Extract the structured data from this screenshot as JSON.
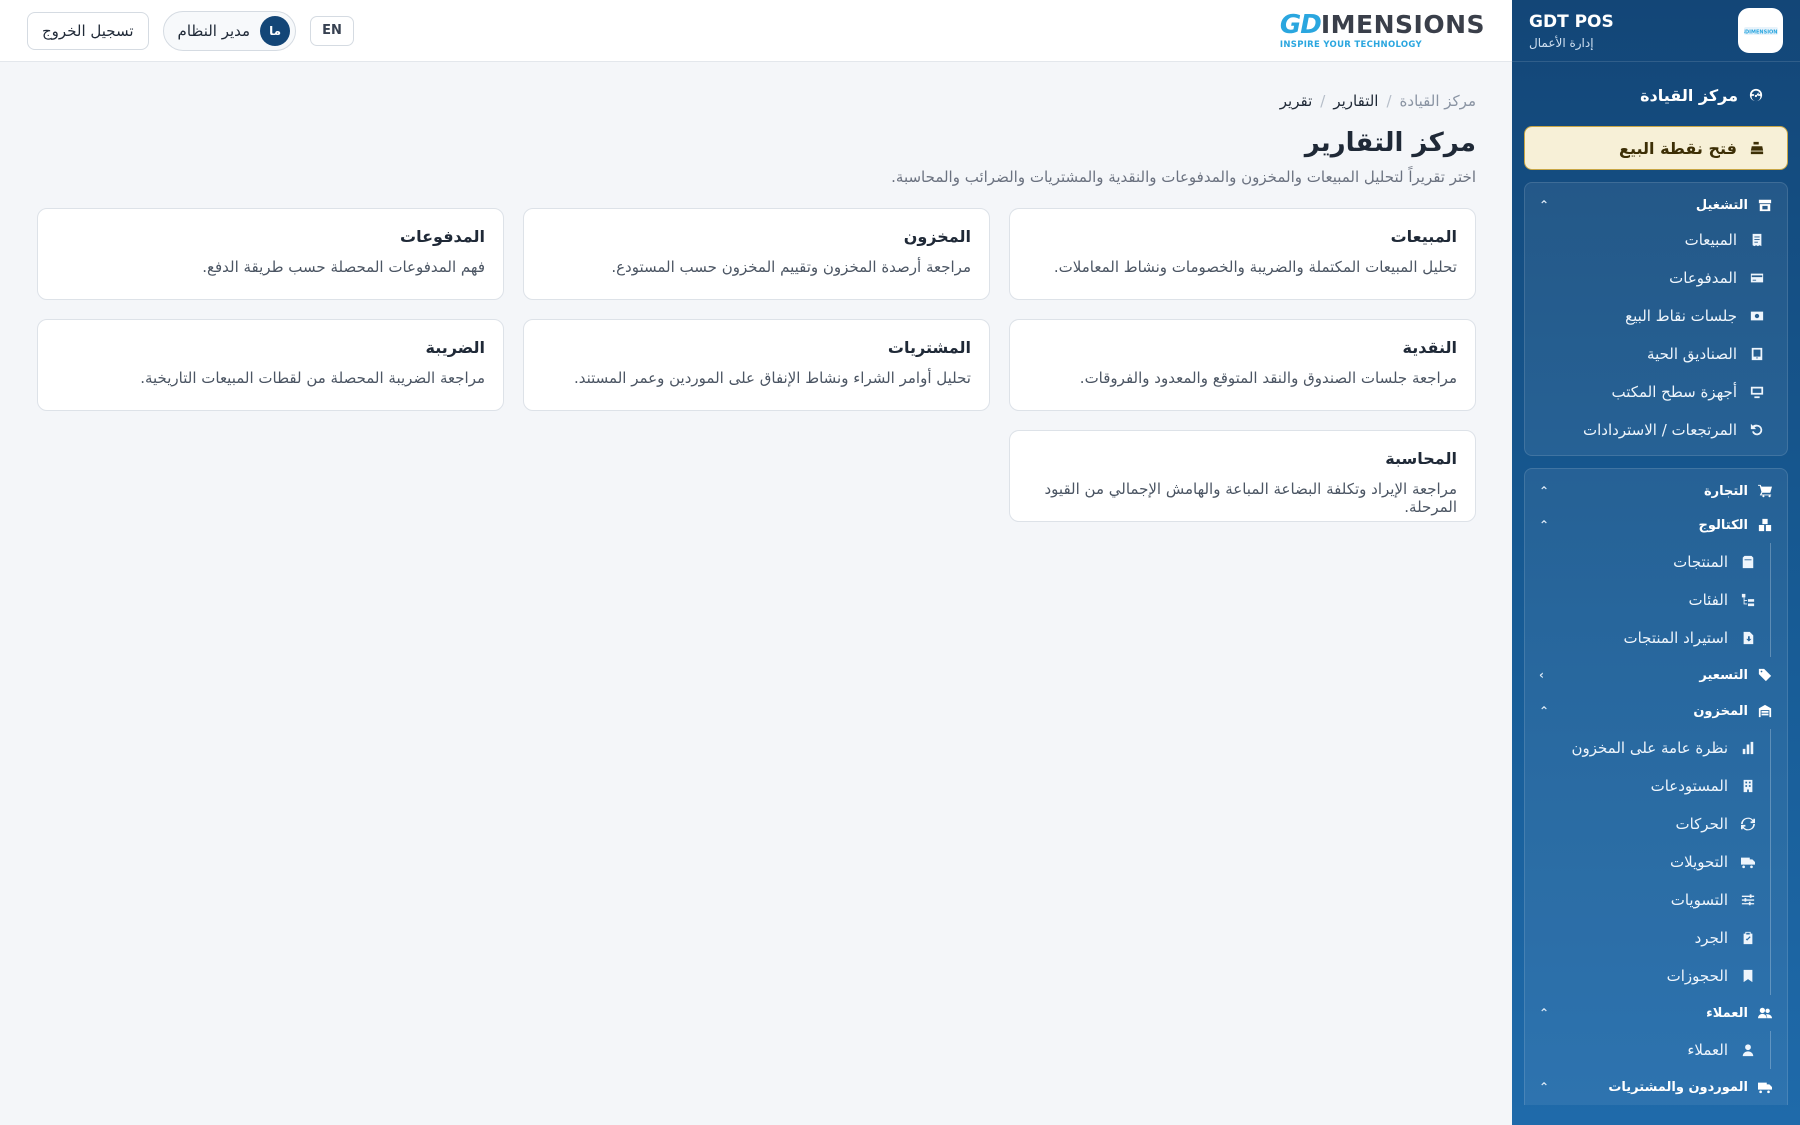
{
  "sidebar": {
    "brand_title": "GDT POS",
    "brand_subtitle": "إدارة الأعمال",
    "dashboard": "مركز القيادة",
    "open_pos": "فتح نقطة البيع",
    "operations": {
      "title": "التشغيل",
      "items": [
        "المبيعات",
        "المدفوعات",
        "جلسات نقاط البيع",
        "الصناديق الحية",
        "أجهزة سطح المكتب",
        "المرتجعات / الاستردادات"
      ]
    },
    "commerce": {
      "title": "التجارة",
      "catalog": {
        "title": "الكتالوج",
        "items": [
          "المنتجات",
          "الفئات",
          "استيراد المنتجات"
        ]
      },
      "pricing": {
        "title": "التسعير"
      },
      "inventory": {
        "title": "المخزون",
        "items": [
          "نظرة عامة على المخزون",
          "المستودعات",
          "الحركات",
          "التحويلات",
          "التسويات",
          "الجرد",
          "الحجوزات"
        ]
      },
      "customers": {
        "title": "العملاء",
        "items": [
          "العملاء"
        ]
      },
      "suppliers": {
        "title": "الموردون والمشتريات"
      }
    }
  },
  "topbar": {
    "logout": "تسجيل الخروج",
    "user_name": "مدير النظام",
    "user_initials": "ما",
    "lang": "EN",
    "logo_gd": "GD",
    "logo_rest": "IMENSIONS",
    "logo_tagline": "INSPIRE YOUR TECHNOLOGY"
  },
  "breadcrumb": [
    "مركز القيادة",
    "التقارير",
    "تقرير"
  ],
  "page": {
    "title": "مركز التقارير",
    "description": "اختر تقريراً لتحليل المبيعات والمخزون والمدفوعات والنقدية والمشتريات والضرائب والمحاسبة."
  },
  "cards": [
    {
      "title": "المبيعات",
      "desc": "تحليل المبيعات المكتملة والضريبة والخصومات ونشاط المعاملات."
    },
    {
      "title": "المخزون",
      "desc": "مراجعة أرصدة المخزون وتقييم المخزون حسب المستودع."
    },
    {
      "title": "المدفوعات",
      "desc": "فهم المدفوعات المحصلة حسب طريقة الدفع."
    },
    {
      "title": "النقدية",
      "desc": "مراجعة جلسات الصندوق والنقد المتوقع والمعدود والفروقات."
    },
    {
      "title": "المشتريات",
      "desc": "تحليل أوامر الشراء ونشاط الإنفاق على الموردين وعمر المستند."
    },
    {
      "title": "الضريبة",
      "desc": "مراجعة الضريبة المحصلة من لقطات المبيعات التاريخية."
    },
    {
      "title": "المحاسبة",
      "desc": "مراجعة الإيراد وتكلفة البضاعة المباعة والهامش الإجمالي من القيود المرحلة."
    }
  ]
}
